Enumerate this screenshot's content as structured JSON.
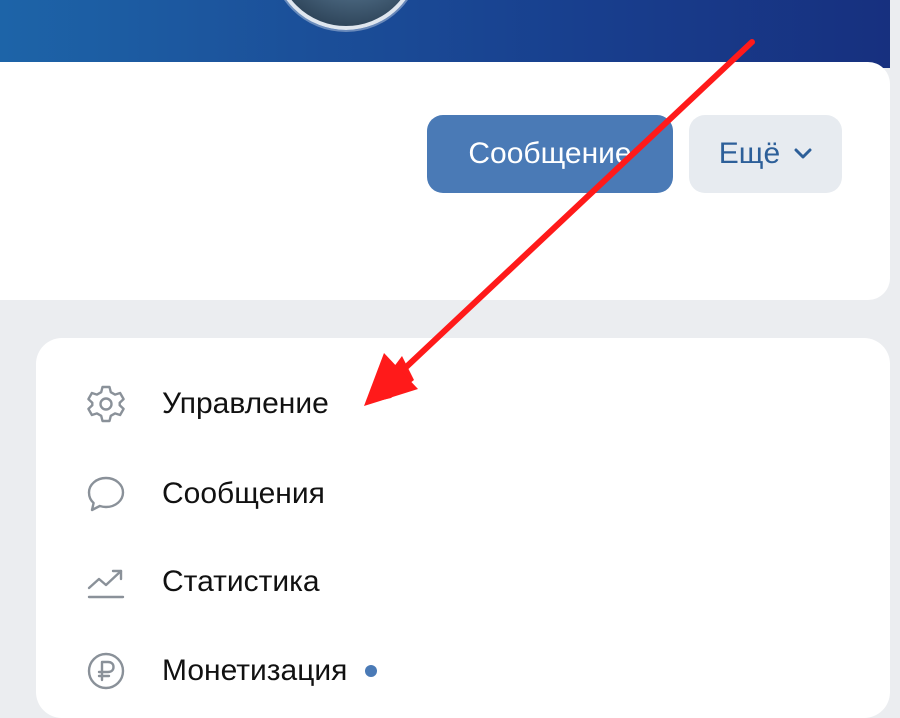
{
  "header": {
    "message_button_label": "Сообщение",
    "more_button_label": "Ещё"
  },
  "menu": {
    "items": [
      {
        "label": "Управление",
        "icon": "gear-icon"
      },
      {
        "label": "Сообщения",
        "icon": "chat-bubble-icon"
      },
      {
        "label": "Статистика",
        "icon": "chart-trend-icon"
      },
      {
        "label": "Монетизация",
        "icon": "ruble-icon",
        "badge": "dot"
      }
    ]
  },
  "colors": {
    "accent": "#4a7ab6",
    "secondary_button_bg": "#e7ebf0",
    "annotation_arrow": "#ff1a1a",
    "cover_start": "#1d64a8",
    "cover_end": "#17307f"
  }
}
